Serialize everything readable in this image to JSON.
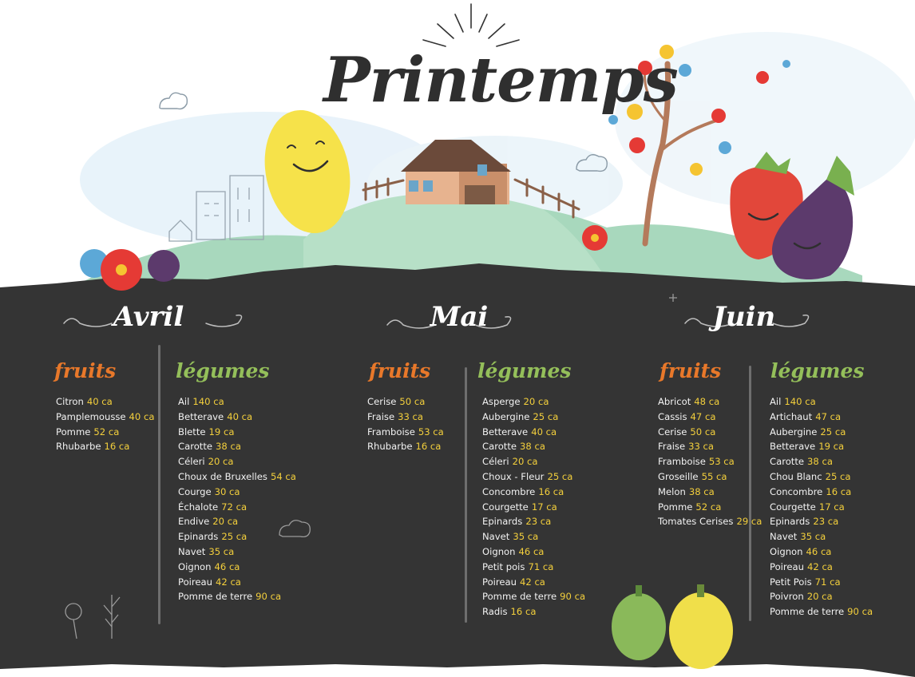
{
  "title": "Printemps",
  "months": [
    {
      "name": "Avril",
      "fruits_label": "fruits",
      "legumes_label": "légumes",
      "fruits": [
        {
          "name": "Citron",
          "cal": "40 ca"
        },
        {
          "name": "Pamplemousse",
          "cal": "40 ca"
        },
        {
          "name": "Pomme",
          "cal": "52 ca"
        },
        {
          "name": "Rhubarbe",
          "cal": "16 ca"
        }
      ],
      "legumes": [
        {
          "name": "Ail",
          "cal": "140 ca"
        },
        {
          "name": "Betterave",
          "cal": "40 ca"
        },
        {
          "name": "Blette",
          "cal": "19 ca"
        },
        {
          "name": "Carotte",
          "cal": "38 ca"
        },
        {
          "name": "Céleri",
          "cal": "20 ca"
        },
        {
          "name": "Choux de Bruxelles",
          "cal": "54 ca"
        },
        {
          "name": "Courge",
          "cal": "30 ca"
        },
        {
          "name": "Échalote",
          "cal": "72 ca"
        },
        {
          "name": "Endive",
          "cal": "20 ca"
        },
        {
          "name": "Epinards",
          "cal": "25 ca"
        },
        {
          "name": "Navet",
          "cal": "35 ca"
        },
        {
          "name": "Oignon",
          "cal": "46 ca"
        },
        {
          "name": "Poireau",
          "cal": "42 ca"
        },
        {
          "name": "Pomme de terre",
          "cal": "90 ca"
        }
      ]
    },
    {
      "name": "Mai",
      "fruits_label": "fruits",
      "legumes_label": "légumes",
      "fruits": [
        {
          "name": "Cerise",
          "cal": "50 ca"
        },
        {
          "name": "Fraise",
          "cal": "33 ca"
        },
        {
          "name": "Framboise",
          "cal": "53 ca"
        },
        {
          "name": "Rhubarbe",
          "cal": "16 ca"
        }
      ],
      "legumes": [
        {
          "name": "Asperge",
          "cal": "20 ca"
        },
        {
          "name": "Aubergine",
          "cal": "25 ca"
        },
        {
          "name": "Betterave",
          "cal": "40 ca"
        },
        {
          "name": "Carotte",
          "cal": "38 ca"
        },
        {
          "name": "Céleri",
          "cal": "20 ca"
        },
        {
          "name": "Choux - Fleur",
          "cal": "25 ca"
        },
        {
          "name": "Concombre",
          "cal": "16 ca"
        },
        {
          "name": "Courgette",
          "cal": "17 ca"
        },
        {
          "name": "Epinards",
          "cal": "23 ca"
        },
        {
          "name": "Navet",
          "cal": "35 ca"
        },
        {
          "name": "Oignon",
          "cal": "46 ca"
        },
        {
          "name": "Petit pois",
          "cal": "71 ca"
        },
        {
          "name": "Poireau",
          "cal": "42 ca"
        },
        {
          "name": "Pomme de terre",
          "cal": "90 ca"
        },
        {
          "name": "Radis",
          "cal": "16 ca"
        }
      ]
    },
    {
      "name": "Juin",
      "fruits_label": "fruits",
      "legumes_label": "légumes",
      "fruits": [
        {
          "name": "Abricot",
          "cal": "48 ca"
        },
        {
          "name": "Cassis",
          "cal": "47 ca"
        },
        {
          "name": "Cerise",
          "cal": "50 ca"
        },
        {
          "name": "Fraise",
          "cal": "33 ca"
        },
        {
          "name": "Framboise",
          "cal": "53 ca"
        },
        {
          "name": "Groseille",
          "cal": "55 ca"
        },
        {
          "name": "Melon",
          "cal": "38 ca"
        },
        {
          "name": "Pomme",
          "cal": "52 ca"
        },
        {
          "name": "Tomates Cerises",
          "cal": "29 ca"
        }
      ],
      "legumes": [
        {
          "name": "Ail",
          "cal": "140 ca"
        },
        {
          "name": "Artichaut",
          "cal": "47 ca"
        },
        {
          "name": "Aubergine",
          "cal": "25 ca"
        },
        {
          "name": "Betterave",
          "cal": "19 ca"
        },
        {
          "name": "Carotte",
          "cal": "38 ca"
        },
        {
          "name": "Chou Blanc",
          "cal": "25 ca"
        },
        {
          "name": "Concombre",
          "cal": "16 ca"
        },
        {
          "name": "Courgette",
          "cal": "17 ca"
        },
        {
          "name": "Epinards",
          "cal": "23 ca"
        },
        {
          "name": "Navet",
          "cal": "35 ca"
        },
        {
          "name": "Oignon",
          "cal": "46 ca"
        },
        {
          "name": "Poireau",
          "cal": "42 ca"
        },
        {
          "name": "Petit Pois",
          "cal": "71 ca"
        },
        {
          "name": "Poivron",
          "cal": "20 ca"
        },
        {
          "name": "Pomme de terre",
          "cal": "90 ca"
        }
      ]
    }
  ],
  "colors": {
    "board": "#343434",
    "fruits_heading": "#e8782a",
    "legumes_heading": "#94bf5a",
    "calorie_value": "#f3cf3c",
    "item_text": "#f2f2f2"
  }
}
